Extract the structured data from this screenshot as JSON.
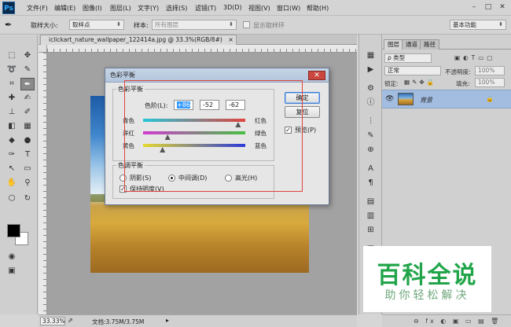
{
  "app": {
    "logo": "Ps",
    "menu": [
      "文件(F)",
      "编辑(E)",
      "图像(I)",
      "图层(L)",
      "文字(Y)",
      "选择(S)",
      "滤镜(T)",
      "3D(D)",
      "视图(V)",
      "窗口(W)",
      "帮助(H)"
    ],
    "window_controls": [
      "–",
      "□",
      "✕"
    ]
  },
  "options": {
    "sample_size_label": "取样大小:",
    "sample_size_value": "取样点",
    "sample_label": "样本:",
    "sample_value": "所有图层",
    "show_ring_label": "显示取样环",
    "workspace": "基本功能"
  },
  "document": {
    "tab_title": "iclickart_nature_wallpaper_122414a.jpg @ 33.3%(RGB/8#)",
    "tab_close": "×",
    "zoom": "33.33%",
    "doc_info": "文档:3.75M/3.75M"
  },
  "dialog": {
    "title": "色彩平衡",
    "close": "✕",
    "group_balance": "色彩平衡",
    "levels_label": "色阶(L):",
    "levels": [
      "+86",
      "-52",
      "-62"
    ],
    "sliders": [
      {
        "left": "青色",
        "right": "红色",
        "value": 86,
        "colors": [
          "#25c6d8",
          "#e0443e"
        ]
      },
      {
        "left": "洋红",
        "right": "绿色",
        "value": -52,
        "colors": [
          "#d23ad0",
          "#46c043"
        ]
      },
      {
        "left": "黄色",
        "right": "蓝色",
        "value": -62,
        "colors": [
          "#e6d82e",
          "#2a3ad8"
        ]
      }
    ],
    "ok": "确定",
    "reset": "复位",
    "preview": "预览(P)",
    "preview_checked": "✓",
    "group_tone": "色调平衡",
    "tones": [
      {
        "label": "阴影(S)",
        "selected": false
      },
      {
        "label": "中间调(D)",
        "selected": true
      },
      {
        "label": "高光(H)",
        "selected": false
      }
    ],
    "preserve_luminosity": "保持明度(V)",
    "preserve_checked": "✓"
  },
  "layers_panel": {
    "tabs": [
      "图层",
      "通道",
      "路径"
    ],
    "kind_filter": "ρ 类型",
    "blend_mode": "正常",
    "opacity_label": "不透明度:",
    "opacity_value": "100%",
    "lock_label": "锁定:",
    "fill_label": "填充:",
    "fill_value": "100%",
    "layer_name": "背景",
    "footer_icons": "⊖ fx ◐ ▣ ▭ ▤ 🗑"
  },
  "watermark": {
    "main": "百科全说",
    "sub": "助你轻松解决"
  }
}
